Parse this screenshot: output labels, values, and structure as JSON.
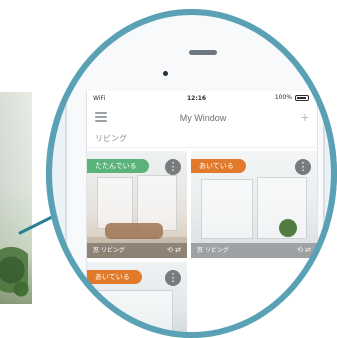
{
  "colors": {
    "ring": "#5aa1b6",
    "online_badge": "#5bb27a",
    "status_badge": "#e27a2b"
  },
  "phone": {
    "statusbar": {
      "left": "WiFi",
      "center": "12:16",
      "right": "100%"
    },
    "nav": {
      "title": "My Window",
      "menu_icon": "menu-icon",
      "add_icon": "plus-icon"
    },
    "section_label": "リビング",
    "tiles": [
      {
        "badge": "たたんでいる",
        "badge_color": "green",
        "footer_label": "窓 リビング",
        "more": "⋮"
      },
      {
        "badge": "あいている",
        "badge_color": "orange",
        "footer_label": "窓 リビング",
        "more": "⋮"
      },
      {
        "badge": "あいている",
        "badge_color": "orange",
        "footer_label": "",
        "more": "⋮"
      }
    ]
  }
}
